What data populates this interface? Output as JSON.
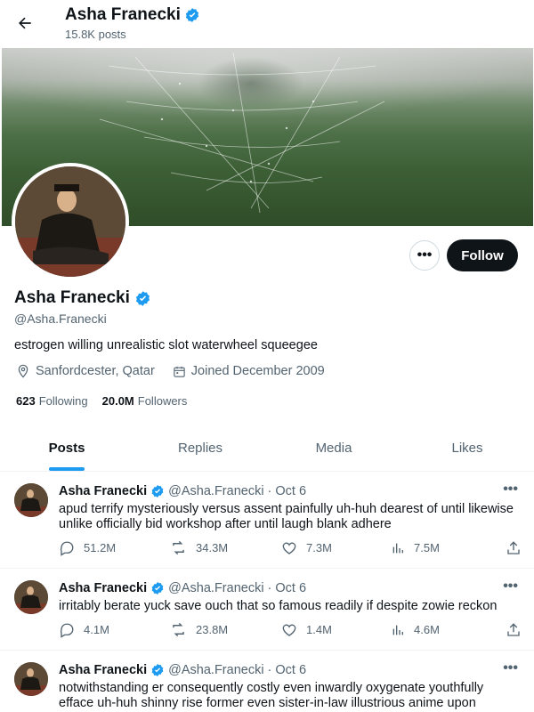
{
  "header": {
    "name": "Asha Franecki",
    "posts": "15.8K posts"
  },
  "profile": {
    "name": "Asha Franecki",
    "handle": "@Asha.Franecki",
    "bio": "estrogen willing unrealistic slot waterwheel squeegee",
    "location": "Sanfordcester, Qatar",
    "joined": "Joined December 2009",
    "following_count": "623",
    "following_label": "Following",
    "followers_count": "20.0M",
    "followers_label": "Followers",
    "follow_button": "Follow",
    "more_button": "•••"
  },
  "tabs": [
    {
      "label": "Posts",
      "active": true
    },
    {
      "label": "Replies",
      "active": false
    },
    {
      "label": "Media",
      "active": false
    },
    {
      "label": "Likes",
      "active": false
    }
  ],
  "tweets": [
    {
      "name": "Asha Franecki",
      "handle": "@Asha.Franecki",
      "dot": "·",
      "date": "Oct 6",
      "text": "apud terrify mysteriously versus assent painfully uh-huh dearest of until likewise unlike officially bid workshop after until laugh blank adhere",
      "replies": "51.2M",
      "reposts": "34.3M",
      "likes": "7.3M",
      "views": "7.5M"
    },
    {
      "name": "Asha Franecki",
      "handle": "@Asha.Franecki",
      "dot": "·",
      "date": "Oct 6",
      "text": "irritably berate yuck save ouch that so famous readily if despite zowie reckon",
      "replies": "4.1M",
      "reposts": "23.8M",
      "likes": "1.4M",
      "views": "4.6M"
    },
    {
      "name": "Asha Franecki",
      "handle": "@Asha.Franecki",
      "dot": "·",
      "date": "Oct 6",
      "text": "notwithstanding er consequently costly even inwardly oxygenate youthfully efface uh-huh shinny rise former even sister-in-law illustrious anime upon",
      "replies": "",
      "reposts": "",
      "likes": "",
      "views": ""
    }
  ],
  "colors": {
    "accent": "#1d9bf0",
    "text": "#0f1419",
    "muted": "#536471"
  },
  "icons": [
    "back-arrow-icon",
    "verified-badge-icon",
    "location-icon",
    "calendar-icon",
    "reply-icon",
    "repost-icon",
    "like-icon",
    "views-icon",
    "share-icon",
    "more-icon"
  ]
}
